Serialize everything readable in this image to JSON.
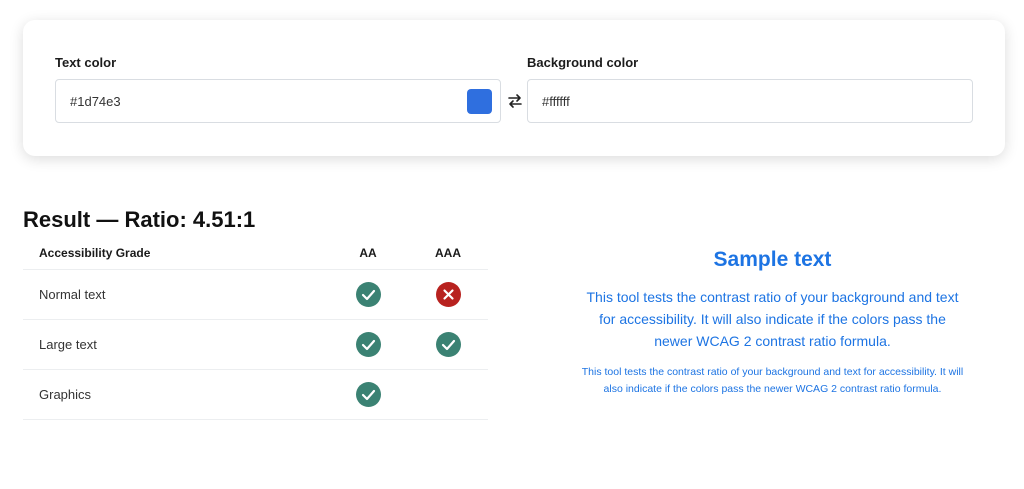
{
  "inputs": {
    "text_color": {
      "label": "Text color",
      "value": "#1d74e3"
    },
    "background_color": {
      "label": "Background color",
      "value": "#ffffff"
    }
  },
  "result": {
    "title": "Result — Ratio: 4.51:1"
  },
  "grades_table": {
    "headers": [
      "Accessibility Grade",
      "AA",
      "AAA"
    ],
    "rows": [
      {
        "label": "Normal text",
        "aa": "pass",
        "aaa": "fail"
      },
      {
        "label": "Large text",
        "aa": "pass",
        "aaa": "pass"
      },
      {
        "label": "Graphics",
        "aa": "pass",
        "aaa": ""
      }
    ]
  },
  "sample": {
    "heading": "Sample text",
    "large_paragraph": "This tool tests the contrast ratio of your background and text for accessibility. It will also indicate if the colors pass the newer WCAG 2 contrast ratio formula.",
    "small_paragraph": "This tool tests the contrast ratio of your background and text for accessibility. It will also indicate if the colors pass the newer WCAG 2 contrast ratio formula."
  },
  "colors": {
    "sample_text": "#1d74e3",
    "pass": "#3b8273",
    "fail": "#b8221f",
    "swatch": "#2f6fdf"
  },
  "icons": {
    "pass": "check-circle-icon",
    "fail": "x-circle-icon",
    "swap": "swap-arrows-icon"
  }
}
